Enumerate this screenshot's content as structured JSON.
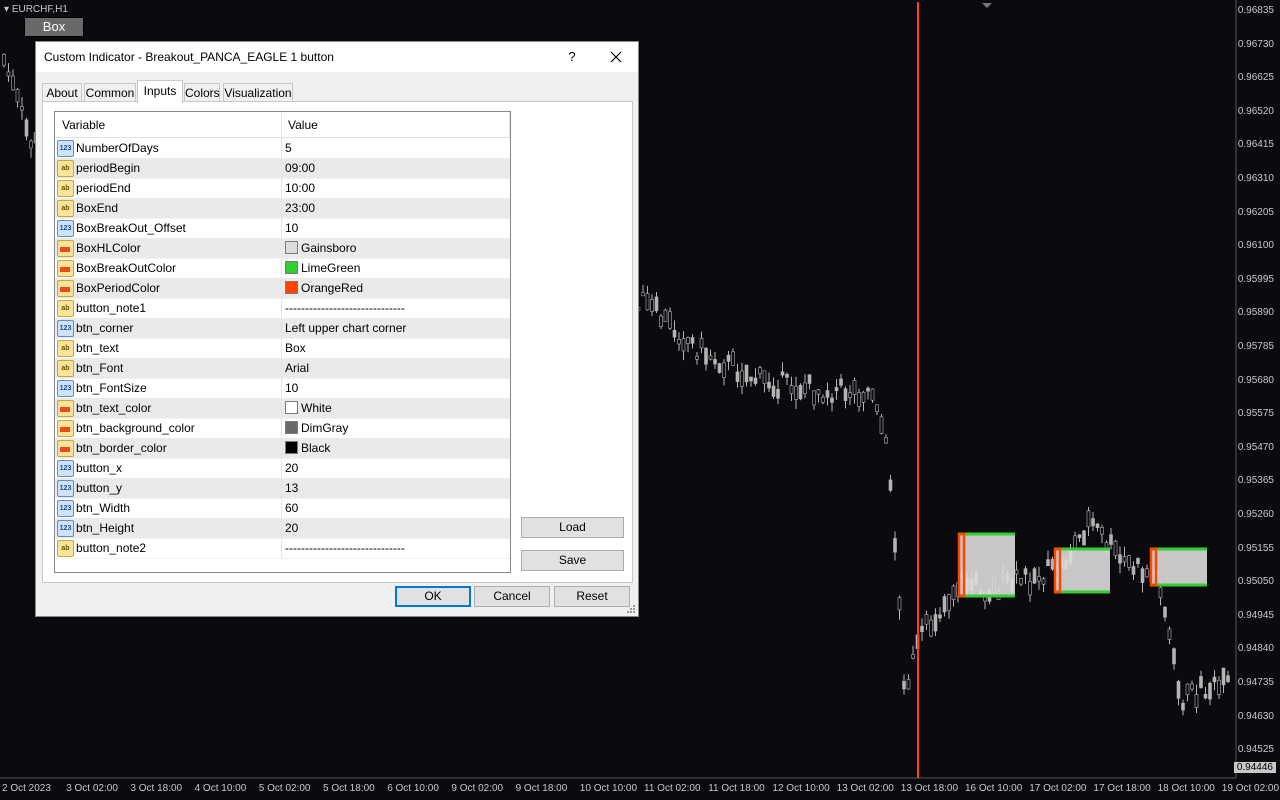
{
  "chart": {
    "symbol": "EURCHF,H1",
    "button_text": "Box",
    "current_price": "0.94446",
    "colors": {
      "background": "#0b0b0f",
      "candle": "#b4b4b4",
      "vline": "#ff4500",
      "box_fill": "#dcdcdc",
      "breakout": "#32cd32",
      "period": "#ff4500"
    },
    "price_labels": [
      "0.96835",
      "0.96730",
      "0.96625",
      "0.96520",
      "0.96415",
      "0.96310",
      "0.96205",
      "0.96100",
      "0.95995",
      "0.95890",
      "0.95785",
      "0.95680",
      "0.95575",
      "0.95470",
      "0.95365",
      "0.95260",
      "0.95155",
      "0.95050",
      "0.94945",
      "0.94840",
      "0.94735",
      "0.94630",
      "0.94525"
    ],
    "time_labels": [
      "2 Oct 2023",
      "3 Oct 02:00",
      "3 Oct 18:00",
      "4 Oct 10:00",
      "5 Oct 02:00",
      "5 Oct 18:00",
      "6 Oct 10:00",
      "9 Oct 02:00",
      "9 Oct 18:00",
      "10 Oct 10:00",
      "11 Oct 02:00",
      "11 Oct 18:00",
      "12 Oct 10:00",
      "13 Oct 02:00",
      "13 Oct 18:00",
      "16 Oct 10:00",
      "17 Oct 02:00",
      "17 Oct 18:00",
      "18 Oct 10:00",
      "19 Oct 02:00"
    ]
  },
  "dialog": {
    "title": "Custom Indicator - Breakout_PANCA_EAGLE 1 button",
    "help": "?",
    "tabs": [
      {
        "label": "About"
      },
      {
        "label": "Common"
      },
      {
        "label": "Inputs",
        "active": true
      },
      {
        "label": "Colors"
      },
      {
        "label": "Visualization"
      }
    ],
    "grid": {
      "col_variable": "Variable",
      "col_value": "Value",
      "rows": [
        {
          "type": "num",
          "name": "NumberOfDays",
          "value": "5"
        },
        {
          "type": "str",
          "name": "periodBegin",
          "value": "09:00"
        },
        {
          "type": "str",
          "name": "periodEnd",
          "value": "10:00"
        },
        {
          "type": "str",
          "name": "BoxEnd",
          "value": "23:00"
        },
        {
          "type": "num",
          "name": "BoxBreakOut_Offset",
          "value": "10"
        },
        {
          "type": "col",
          "name": "BoxHLColor",
          "value": "Gainsboro",
          "swatch": "#dcdcdc"
        },
        {
          "type": "col",
          "name": "BoxBreakOutColor",
          "value": "LimeGreen",
          "swatch": "#32cd32"
        },
        {
          "type": "col",
          "name": "BoxPeriodColor",
          "value": "OrangeRed",
          "swatch": "#ff4500"
        },
        {
          "type": "str",
          "name": "button_note1",
          "value": "------------------------------"
        },
        {
          "type": "num",
          "name": "btn_corner",
          "value": "Left upper chart corner"
        },
        {
          "type": "str",
          "name": "btn_text",
          "value": "Box"
        },
        {
          "type": "str",
          "name": "btn_Font",
          "value": "Arial"
        },
        {
          "type": "num",
          "name": "btn_FontSize",
          "value": "10"
        },
        {
          "type": "col",
          "name": "btn_text_color",
          "value": "White",
          "swatch": "#ffffff"
        },
        {
          "type": "col",
          "name": "btn_background_color",
          "value": "DimGray",
          "swatch": "#696969"
        },
        {
          "type": "col",
          "name": "btn_border_color",
          "value": "Black",
          "swatch": "#000000"
        },
        {
          "type": "num",
          "name": "button_x",
          "value": "20"
        },
        {
          "type": "num",
          "name": "button_y",
          "value": "13"
        },
        {
          "type": "num",
          "name": "btn_Width",
          "value": "60"
        },
        {
          "type": "num",
          "name": "btn_Height",
          "value": "20"
        },
        {
          "type": "str",
          "name": "button_note2",
          "value": "------------------------------"
        }
      ]
    },
    "buttons": {
      "load": "Load",
      "save": "Save",
      "ok": "OK",
      "cancel": "Cancel",
      "reset": "Reset"
    }
  }
}
